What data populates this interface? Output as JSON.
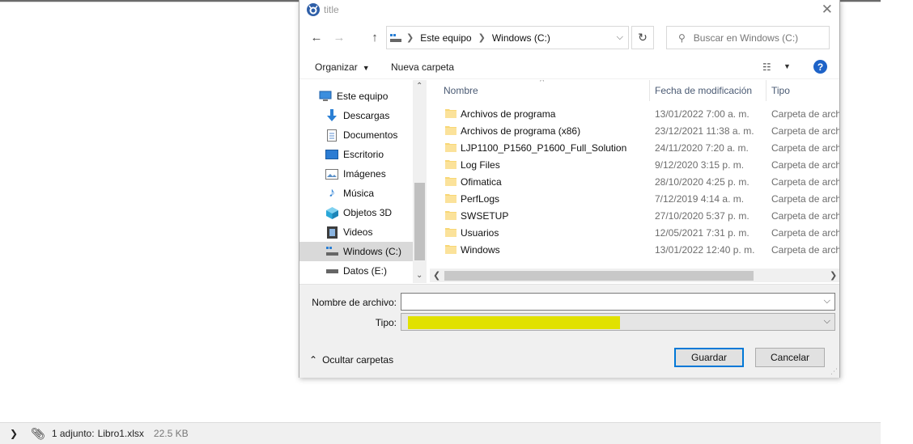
{
  "dialog": {
    "title": "title",
    "nav": {
      "breadcrumb": [
        "Este equipo",
        "Windows  (C:)"
      ],
      "search_placeholder": "Buscar en Windows  (C:)"
    },
    "toolbar": {
      "organize_label": "Organizar",
      "new_folder_label": "Nueva carpeta",
      "help_label": "?"
    },
    "navpane": {
      "items": [
        {
          "label": "Este equipo",
          "icon": "computer-icon"
        },
        {
          "label": "Descargas",
          "icon": "downloads-icon"
        },
        {
          "label": "Documentos",
          "icon": "documents-icon"
        },
        {
          "label": "Escritorio",
          "icon": "desktop-icon"
        },
        {
          "label": "Imágenes",
          "icon": "pictures-icon"
        },
        {
          "label": "Música",
          "icon": "music-icon"
        },
        {
          "label": "Objetos 3D",
          "icon": "objects3d-icon"
        },
        {
          "label": "Videos",
          "icon": "videos-icon"
        },
        {
          "label": "Windows  (C:)",
          "icon": "drive-c-icon",
          "selected": true
        },
        {
          "label": "Datos (E:)",
          "icon": "drive-e-icon"
        }
      ]
    },
    "files": {
      "columns": [
        "Nombre",
        "Fecha de modificación",
        "Tipo"
      ],
      "rows": [
        {
          "name": "Archivos de programa",
          "date": "13/01/2022 7:00 a. m.",
          "type": "Carpeta de archi"
        },
        {
          "name": "Archivos de programa (x86)",
          "date": "23/12/2021 11:38 a. m.",
          "type": "Carpeta de archi"
        },
        {
          "name": "LJP1100_P1560_P1600_Full_Solution",
          "date": "24/11/2020 7:20 a. m.",
          "type": "Carpeta de archi"
        },
        {
          "name": "Log Files",
          "date": "9/12/2020 3:15 p. m.",
          "type": "Carpeta de archi"
        },
        {
          "name": "Ofimatica",
          "date": "28/10/2020 4:25 p. m.",
          "type": "Carpeta de archi"
        },
        {
          "name": "PerfLogs",
          "date": "7/12/2019 4:14 a. m.",
          "type": "Carpeta de archi"
        },
        {
          "name": "SWSETUP",
          "date": "27/10/2020 5:37 p. m.",
          "type": "Carpeta de archi"
        },
        {
          "name": "Usuarios",
          "date": "12/05/2021 7:31 p. m.",
          "type": "Carpeta de archi"
        },
        {
          "name": "Windows",
          "date": "13/01/2022 12:40 p. m.",
          "type": "Carpeta de archi"
        }
      ]
    },
    "form": {
      "filename_label": "Nombre de archivo:",
      "filename_value": "",
      "type_label": "Tipo:",
      "type_value": "",
      "hide_folders_label": "Ocultar carpetas",
      "save_label": "Guardar",
      "cancel_label": "Cancelar"
    }
  },
  "attachment": {
    "label": "1 adjunto:",
    "filename": "Libro1.xlsx",
    "size": "22.5 KB"
  },
  "colors": {
    "accent": "#0078d7",
    "selection": "#d9d9d9",
    "highlight": "#e1e100",
    "folder": "#f8d775"
  }
}
